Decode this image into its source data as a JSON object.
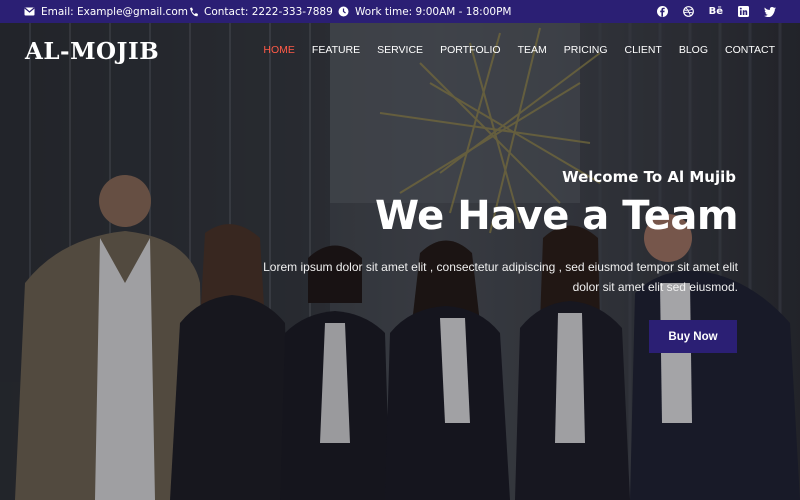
{
  "topbar": {
    "email": "Email: Example@gmail.com",
    "contact": "Contact: 2222-333-7889",
    "worktime": "Work time: 9:00AM - 18:00PM",
    "socials": [
      "facebook-icon",
      "dribbble-icon",
      "behance-icon",
      "linkedin-icon",
      "twitter-icon"
    ],
    "behance_label": "Bē"
  },
  "header": {
    "logo": "AL-MOJIB",
    "nav": [
      "HOME",
      "FEATURE",
      "SERVICE",
      "PORTFOLIO",
      "TEAM",
      "PRICING",
      "CLIENT",
      "BLOG",
      "CONTACT"
    ],
    "active_index": 0
  },
  "hero": {
    "welcome": "Welcome To Al Mujib",
    "headline": "We Have a Team",
    "paragraph": "Lorem ipsum dolor sit amet elit , consectetur adipiscing , sed eiusmod tempor sit amet elit dolor sit amet elit sed eiusmod.",
    "button": "Buy Now"
  },
  "colors": {
    "topbar": "#2b1f74",
    "accent": "#ff5a47",
    "button": "#2b1f74"
  }
}
